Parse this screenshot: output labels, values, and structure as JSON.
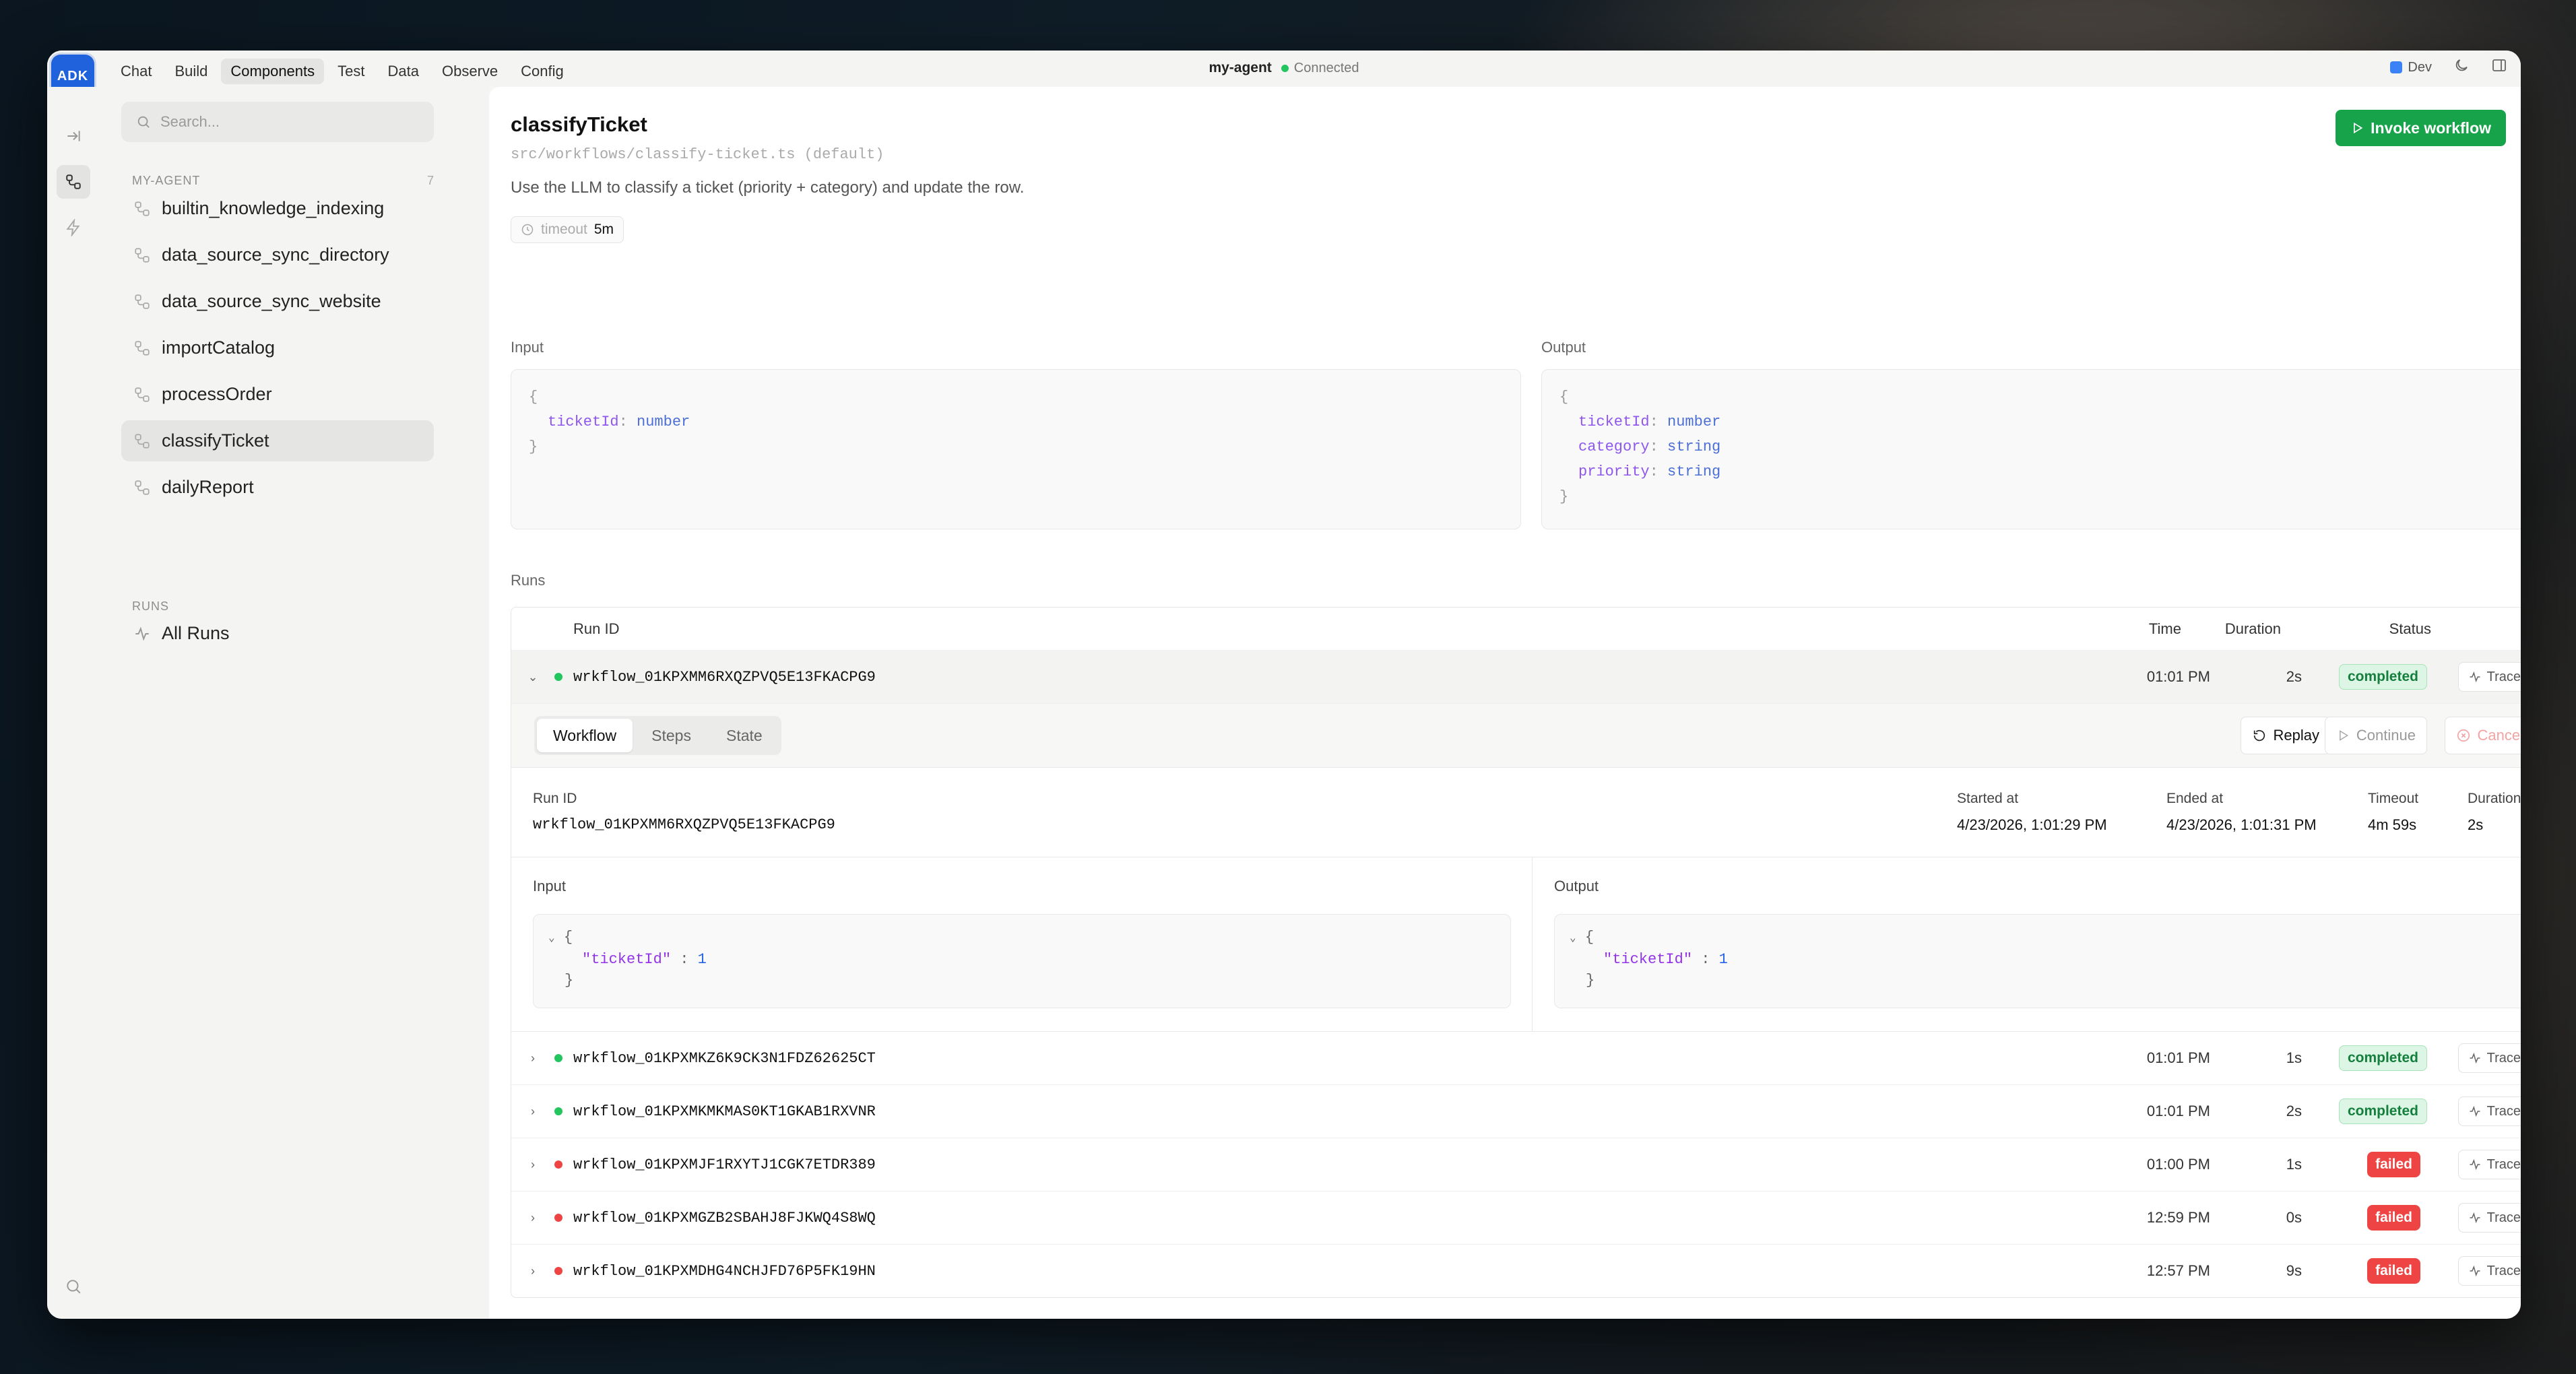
{
  "app": {
    "logo": "ADK"
  },
  "topnav": [
    "Chat",
    "Build",
    "Components",
    "Test",
    "Data",
    "Observe",
    "Config"
  ],
  "topnav_active": "Components",
  "agent": {
    "name": "my-agent",
    "status": "Connected"
  },
  "env": {
    "label": "Dev"
  },
  "sidebar": {
    "search_placeholder": "Search...",
    "section": "MY-AGENT",
    "count": "7",
    "items": [
      "builtin_knowledge_indexing",
      "data_source_sync_directory",
      "data_source_sync_website",
      "importCatalog",
      "processOrder",
      "classifyTicket",
      "dailyReport"
    ],
    "active": "classifyTicket",
    "runs_section": "RUNS",
    "runs_item": "All Runs"
  },
  "workflow": {
    "name": "classifyTicket",
    "path": "src/workflows/classify-ticket.ts (default)",
    "description": "Use the LLM to classify a ticket (priority + category) and update the row.",
    "timeout_label": "timeout",
    "timeout_value": "5m",
    "invoke_label": "Invoke workflow"
  },
  "schema": {
    "input_label": "Input",
    "output_label": "Output",
    "input_fields": [
      {
        "key": "ticketId",
        "type": "number"
      }
    ],
    "output_fields": [
      {
        "key": "ticketId",
        "type": "number"
      },
      {
        "key": "category",
        "type": "string"
      },
      {
        "key": "priority",
        "type": "string"
      }
    ]
  },
  "runs": {
    "label": "Runs",
    "columns": {
      "run_id": "Run ID",
      "time": "Time",
      "duration": "Duration",
      "status": "Status"
    },
    "traces_label": "Traces",
    "rows": [
      {
        "id": "wrkflow_01KPXMM6RXQZPVQ5E13FKACPG9",
        "time": "01:01 PM",
        "duration": "2s",
        "status": "completed"
      },
      {
        "id": "wrkflow_01KPXMKZ6K9CK3N1FDZ62625CT",
        "time": "01:01 PM",
        "duration": "1s",
        "status": "completed"
      },
      {
        "id": "wrkflow_01KPXMKMKMAS0KT1GKAB1RXVNR",
        "time": "01:01 PM",
        "duration": "2s",
        "status": "completed"
      },
      {
        "id": "wrkflow_01KPXMJF1RXYTJ1CGK7ETDR389",
        "time": "01:00 PM",
        "duration": "1s",
        "status": "failed"
      },
      {
        "id": "wrkflow_01KPXMGZB2SBAHJ8FJKWQ4S8WQ",
        "time": "12:59 PM",
        "duration": "0s",
        "status": "failed"
      },
      {
        "id": "wrkflow_01KPXMDHG4NCHJFD76P5FK19HN",
        "time": "12:57 PM",
        "duration": "9s",
        "status": "failed"
      }
    ]
  },
  "detail": {
    "tabs": [
      "Workflow",
      "Steps",
      "State"
    ],
    "tab_active": "Workflow",
    "replay": "Replay",
    "continue": "Continue",
    "cancel": "Cancel",
    "run_id_label": "Run ID",
    "run_id": "wrkflow_01KPXMM6RXQZPVQ5E13FKACPG9",
    "started_label": "Started at",
    "started": "4/23/2026, 1:01:29 PM",
    "ended_label": "Ended at",
    "ended": "4/23/2026, 1:01:31 PM",
    "timeout_label": "Timeout",
    "timeout": "4m 59s",
    "duration_label": "Duration",
    "duration": "2s",
    "input_label": "Input",
    "output_label": "Output",
    "json_key": "\"ticketId\"",
    "json_value": "1"
  },
  "colors": {
    "accent": "#1f62dc",
    "success": "#16a34a",
    "danger": "#ef4444"
  }
}
